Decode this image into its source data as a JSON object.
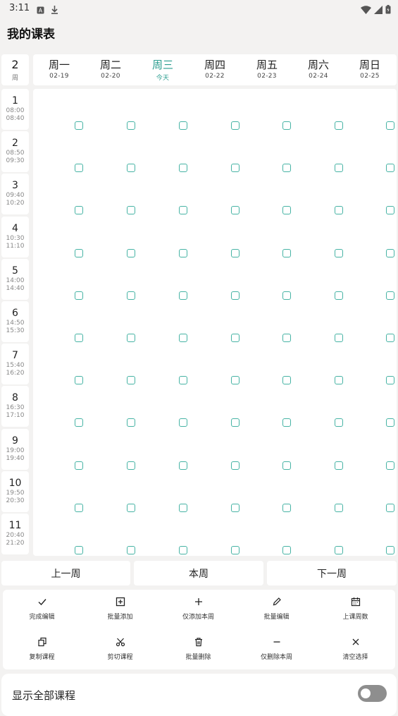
{
  "status": {
    "time": "3:11"
  },
  "app": {
    "title": "我的课表"
  },
  "week": {
    "number": "2",
    "unit": "周"
  },
  "days": [
    {
      "name": "周一",
      "date": "02-19",
      "today": false
    },
    {
      "name": "周二",
      "date": "02-20",
      "today": false
    },
    {
      "name": "周三",
      "date": "今天",
      "today": true
    },
    {
      "name": "周四",
      "date": "02-22",
      "today": false
    },
    {
      "name": "周五",
      "date": "02-23",
      "today": false
    },
    {
      "name": "周六",
      "date": "02-24",
      "today": false
    },
    {
      "name": "周日",
      "date": "02-25",
      "today": false
    }
  ],
  "periods": [
    {
      "num": "1",
      "start": "08:00",
      "end": "08:40"
    },
    {
      "num": "2",
      "start": "08:50",
      "end": "09:30"
    },
    {
      "num": "3",
      "start": "09:40",
      "end": "10:20"
    },
    {
      "num": "4",
      "start": "10:30",
      "end": "11:10"
    },
    {
      "num": "5",
      "start": "14:00",
      "end": "14:40"
    },
    {
      "num": "6",
      "start": "14:50",
      "end": "15:30"
    },
    {
      "num": "7",
      "start": "15:40",
      "end": "16:20"
    },
    {
      "num": "8",
      "start": "16:30",
      "end": "17:10"
    },
    {
      "num": "9",
      "start": "19:00",
      "end": "19:40"
    },
    {
      "num": "10",
      "start": "19:50",
      "end": "20:30"
    },
    {
      "num": "11",
      "start": "20:40",
      "end": "21:20"
    }
  ],
  "nav": {
    "prev": "上一周",
    "current": "本周",
    "next": "下一周"
  },
  "tools": [
    {
      "label": "完成编辑",
      "icon": "check-icon"
    },
    {
      "label": "批量添加",
      "icon": "add-box-icon"
    },
    {
      "label": "仅添加本周",
      "icon": "plus-icon"
    },
    {
      "label": "批量编辑",
      "icon": "pencil-icon"
    },
    {
      "label": "上课周数",
      "icon": "calendar-icon"
    },
    {
      "label": "复制课程",
      "icon": "copy-icon"
    },
    {
      "label": "剪切课程",
      "icon": "scissors-icon"
    },
    {
      "label": "批量删除",
      "icon": "trash-icon"
    },
    {
      "label": "仅删除本周",
      "icon": "minus-icon"
    },
    {
      "label": "清空选择",
      "icon": "close-icon"
    }
  ],
  "bottom": {
    "show_all_label": "显示全部课程",
    "show_all_on": false
  },
  "colors": {
    "accent": "#2a9d8f",
    "checkbox": "#46b3a4",
    "background": "#f3f2f1"
  }
}
